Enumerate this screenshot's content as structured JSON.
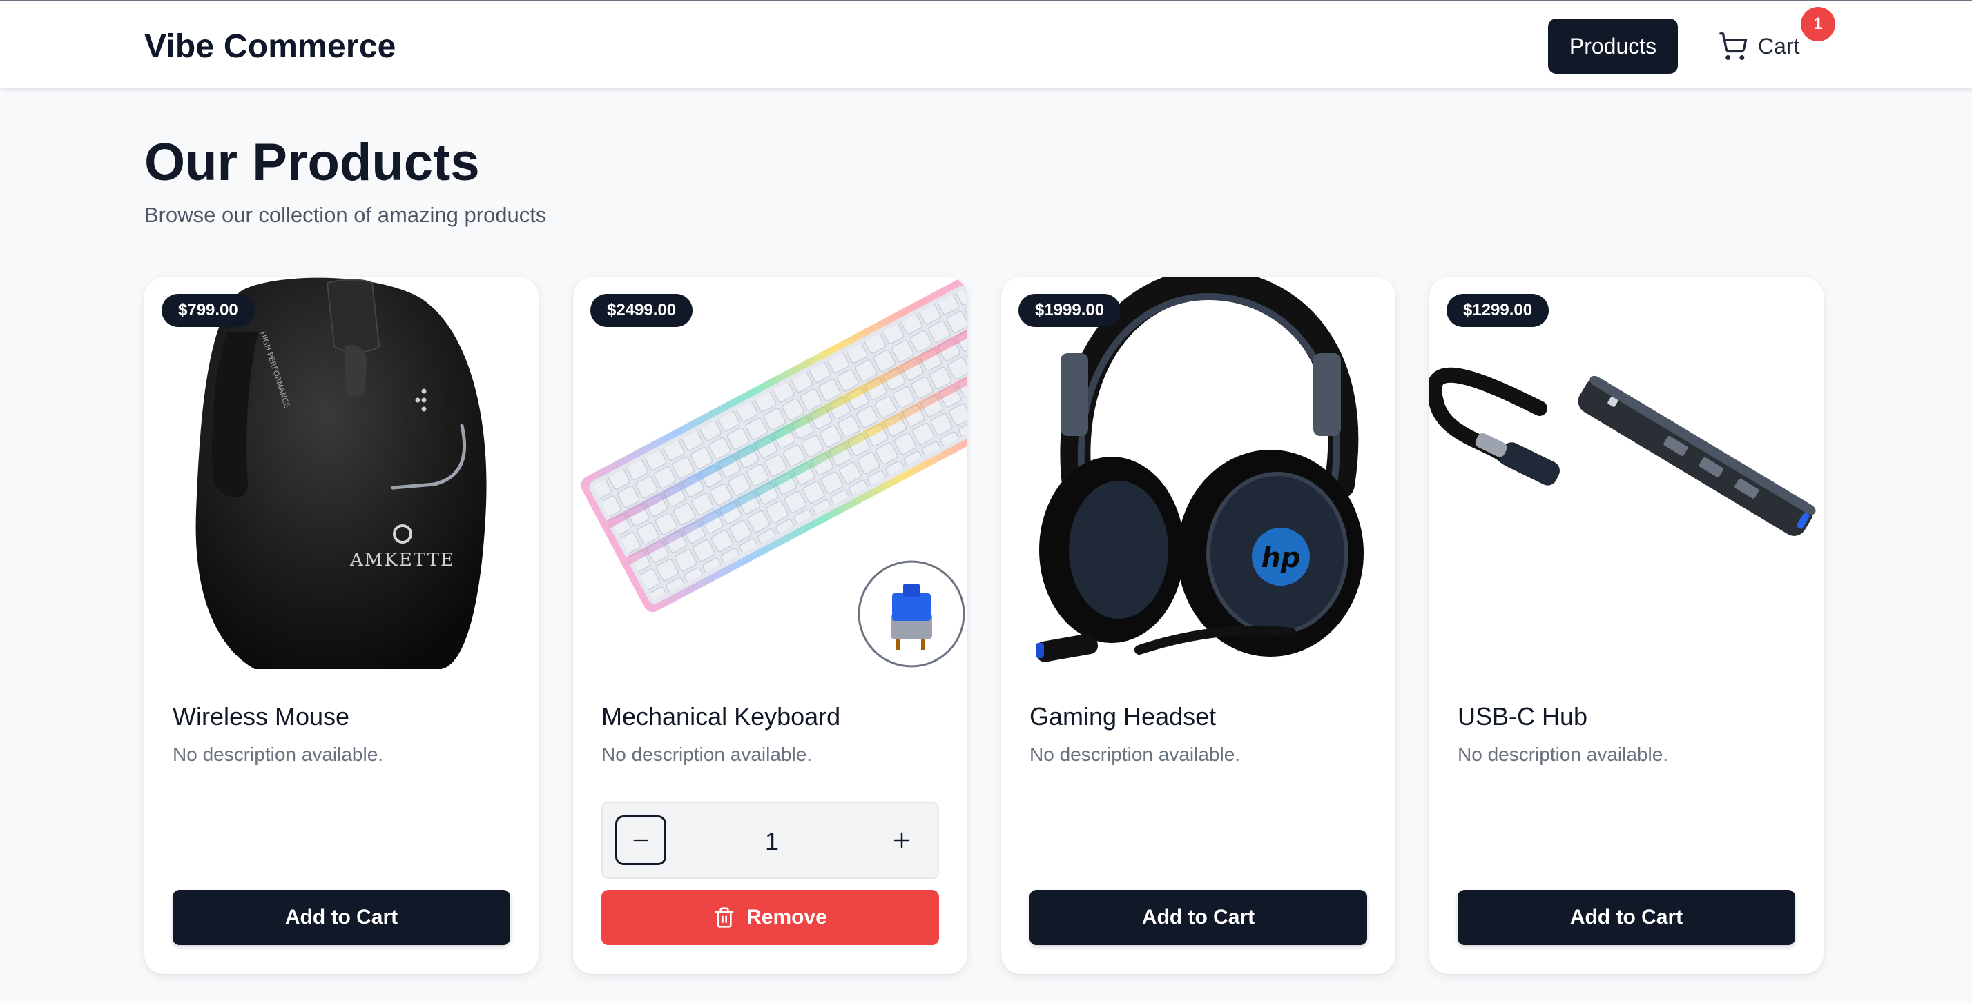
{
  "header": {
    "brand": "Vibe Commerce",
    "nav_products": "Products",
    "nav_cart": "Cart",
    "cart_count": "1"
  },
  "page": {
    "title": "Our Products",
    "subtitle": "Browse our collection of amazing products"
  },
  "products": [
    {
      "name": "Wireless Mouse",
      "price": "$799.00",
      "description": "No description available.",
      "action": "Add to Cart",
      "brand_mark": "AMKETTE",
      "side_text": "HIGH PERFORMANCE"
    },
    {
      "name": "Mechanical Keyboard",
      "price": "$2499.00",
      "description": "No description available.",
      "action": "Remove",
      "quantity": "1"
    },
    {
      "name": "Gaming Headset",
      "price": "$1999.00",
      "description": "No description available.",
      "action": "Add to Cart",
      "brand_mark": "hp"
    },
    {
      "name": "USB-C Hub",
      "price": "$1299.00",
      "description": "No description available.",
      "action": "Add to Cart"
    }
  ],
  "icons": {
    "cart": "shopping-cart-icon",
    "minus": "minus-icon",
    "plus": "plus-icon",
    "trash": "trash-icon"
  },
  "colors": {
    "primary": "#111827",
    "danger": "#ef4444",
    "background": "#f8f9fb",
    "card": "#ffffff",
    "muted_text": "#6b7280"
  }
}
